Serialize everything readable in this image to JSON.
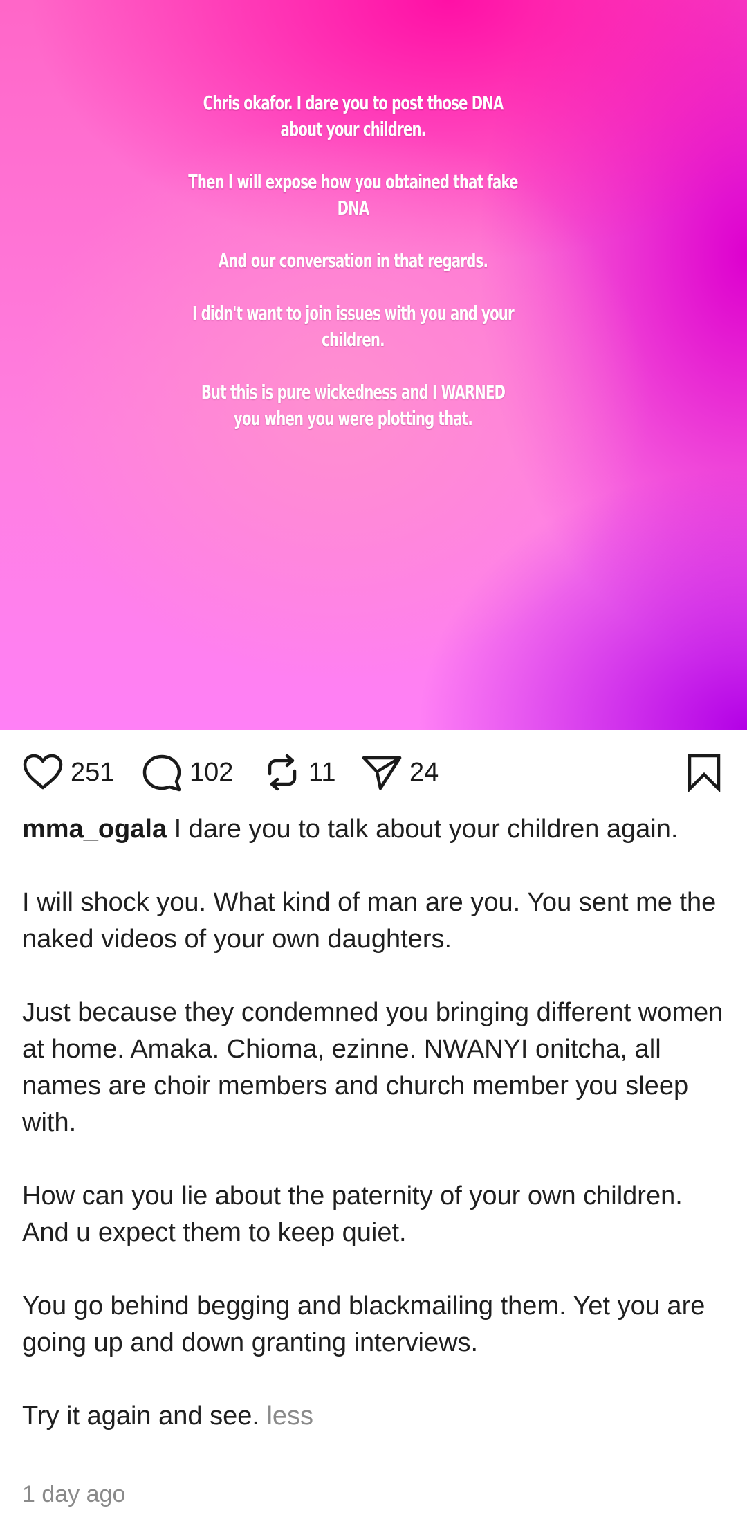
{
  "post": {
    "image_text": [
      "Chris okafor. I dare you to post those DNA about your children.",
      "Then I will expose how you obtained that fake DNA",
      "And our conversation in that regards.",
      "I didn't want to join issues with you and your children.",
      "But this is pure wickedness and I WARNED you when you were plotting that."
    ],
    "gradient_colors": [
      "#ff10a6",
      "#ff80f6",
      "#dd00cf",
      "#b300e6"
    ]
  },
  "actions": {
    "likes": "251",
    "comments": "102",
    "reposts": "11",
    "shares": "24",
    "icons": [
      "heart-icon",
      "comment-icon",
      "repost-icon",
      "share-icon",
      "bookmark-icon"
    ]
  },
  "caption": {
    "username": "mma_ogala",
    "first_line": " I dare you to talk about your children again.",
    "paragraphs": [
      "I will shock you. What kind of man are you. You sent me the naked videos of your own daughters.",
      "Just because they condemned you bringing different women at home.  Amaka. Chioma,  ezinne. NWANYI onitcha, all names are choir members and church member you sleep with.",
      "How can you lie about the paternity of your own children.  And u expect them to keep quiet.",
      "You go behind begging and blackmailing them. Yet you are going up and down granting interviews."
    ],
    "last_line": "Try it again and see.",
    "less_label": " less"
  },
  "meta": {
    "timestamp": "1 day ago"
  }
}
